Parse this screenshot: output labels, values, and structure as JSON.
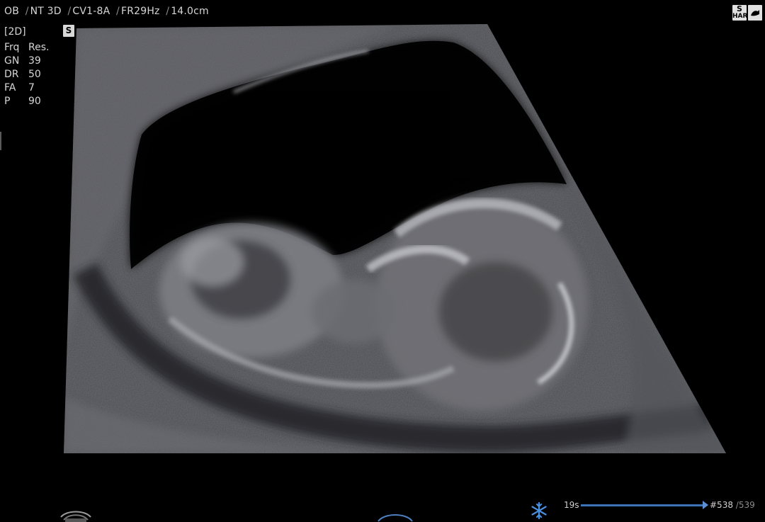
{
  "header": {
    "segments": [
      {
        "text": "OB"
      },
      {
        "text": "NT 3D"
      },
      {
        "text": "CV1-8A"
      },
      {
        "text": "FR29Hz"
      },
      {
        "text": "14.0cm"
      }
    ]
  },
  "top_icons": {
    "har_badge": {
      "line1": "S",
      "line2": "HAR"
    },
    "probe_badge_icon": "probe-hand-icon"
  },
  "mode": {
    "label": "[2D]",
    "badge": "S"
  },
  "params": [
    {
      "key": "Frq",
      "value": "Res."
    },
    {
      "key": "GN",
      "value": "39"
    },
    {
      "key": "DR",
      "value": "50"
    },
    {
      "key": "FA",
      "value": "7"
    },
    {
      "key": "P",
      "value": "90"
    }
  ],
  "cine": {
    "time": "19s",
    "frame_current": "#538",
    "frame_separator": "/",
    "frame_total": "539",
    "freeze_icon": "snowflake-icon",
    "progress": 0.998
  },
  "colors": {
    "background": "#000000",
    "text": "#d6d6d6",
    "cine_blue": "#3d73b8",
    "freeze_blue": "#4a8fe0"
  }
}
